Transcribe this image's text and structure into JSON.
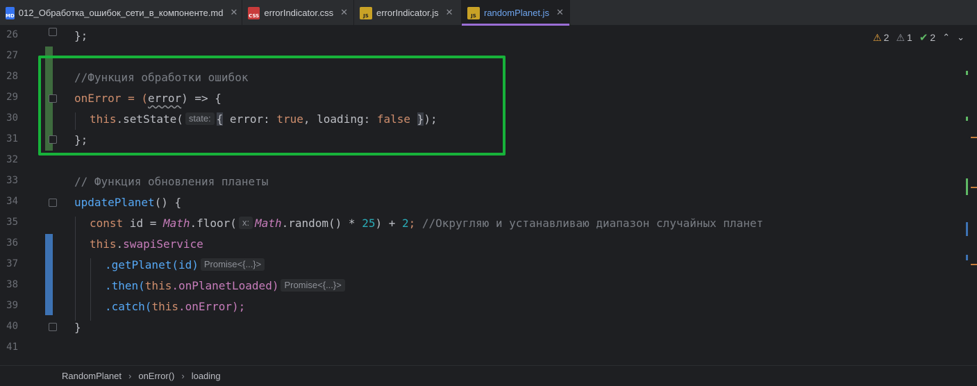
{
  "tabs": [
    {
      "label": "012_Обработка_ошибок_сети_в_компоненте.md",
      "icon_text": "MD",
      "icon_color": "#3574f0",
      "active": false
    },
    {
      "label": "errorIndicator.css",
      "icon_text": "CSS",
      "icon_color": "#c93b3b",
      "active": false
    },
    {
      "label": "errorIndicator.js",
      "icon_text": "JS",
      "icon_color": "#c9a226",
      "active": false
    },
    {
      "label": "randomPlanet.js",
      "icon_text": "JS",
      "icon_color": "#c9a226",
      "active": true
    }
  ],
  "close_glyph": "✕",
  "inspections": {
    "warnings": "2",
    "weak_warnings": "1",
    "ok": "2"
  },
  "line_numbers": [
    "26",
    "27",
    "28",
    "29",
    "30",
    "31",
    "32",
    "33",
    "34",
    "35",
    "36",
    "37",
    "38",
    "39",
    "40",
    "41"
  ],
  "code": {
    "l26": "};",
    "l28": "//Функция обработки ошибок",
    "l29_a": "onError = (",
    "l29_b": "error",
    "l29_c": ") => {",
    "l30_a": "this",
    "l30_b": ".setState(",
    "l30_hint": "state:",
    "l30_c": "{",
    "l30_d": " error: ",
    "l30_e": "true",
    "l30_f": ", loading: ",
    "l30_g": "false",
    "l30_h": " ",
    "l30_i": "}",
    "l30_j": ");",
    "l31": "};",
    "l33": "// Функция обновления планеты",
    "l34_a": "updatePlanet",
    "l34_b": "() {",
    "l35_a": "const",
    "l35_b": " id = ",
    "l35_c": "Math",
    "l35_d": ".floor(",
    "l35_hint": "x:",
    "l35_e": "Math",
    "l35_f": ".random() * ",
    "l35_g": "25",
    "l35_h": ") + ",
    "l35_i": "2",
    "l35_j": ";",
    "l35_k": " //Округляю и устанавливаю диапазон случайных планет",
    "l36_a": "this",
    "l36_b": ".",
    "l36_c": "swapiService",
    "l37_a": ".getPlanet(id)",
    "l37_hint": "Promise<{...}>",
    "l38_a": ".then(",
    "l38_b": "this",
    "l38_c": ".onPlanetLoaded)",
    "l38_hint": "Promise<{...}>",
    "l39_a": ".catch(",
    "l39_b": "this",
    "l39_c": ".onError);",
    "l40": "}"
  },
  "breadcrumb": [
    "RandomPlanet",
    "onError()",
    "loading"
  ],
  "colors": {
    "highlight_box": "#17b23a",
    "modified_gutter": "#3e6b3e",
    "changed_gutter": "#3d72b3"
  }
}
